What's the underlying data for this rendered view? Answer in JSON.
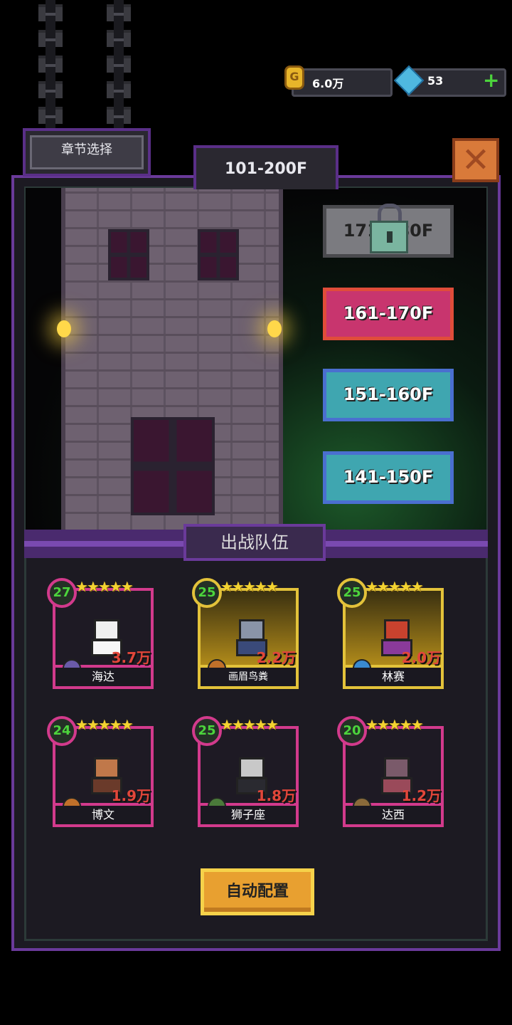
{
  "currency": {
    "gold": "6.0万",
    "gems": "53"
  },
  "header": {
    "chapter_select": "章节选择",
    "range_title": "101-200F"
  },
  "floors": [
    {
      "label": "171-180F",
      "state": "locked"
    },
    {
      "label": "161-170F",
      "state": "current"
    },
    {
      "label": "151-160F",
      "state": "cleared"
    },
    {
      "label": "141-150F",
      "state": "cleared"
    }
  ],
  "team": {
    "title": "出战队伍",
    "heroes": [
      {
        "name": "海达",
        "level": "27",
        "stars": 5,
        "power": "3.7万",
        "frame": "pink"
      },
      {
        "name": "画眉鸟粪",
        "level": "25",
        "stars": 5,
        "power": "2.2万",
        "frame": "gold"
      },
      {
        "name": "林赛",
        "level": "25",
        "stars": 5,
        "power": "2.0万",
        "frame": "gold"
      },
      {
        "name": "博文",
        "level": "24",
        "stars": 5,
        "power": "1.9万",
        "frame": "pink"
      },
      {
        "name": "狮子座",
        "level": "25",
        "stars": 5,
        "power": "1.8万",
        "frame": "pink"
      },
      {
        "name": "达西",
        "level": "20",
        "stars": 5,
        "power": "1.2万",
        "frame": "pink"
      }
    ]
  },
  "auto_config": "自动配置",
  "colors": {
    "accent_purple": "#6a3a9a",
    "power_red": "#e2463a",
    "level_green": "#4cd43c",
    "star_gold": "#f3d331"
  }
}
